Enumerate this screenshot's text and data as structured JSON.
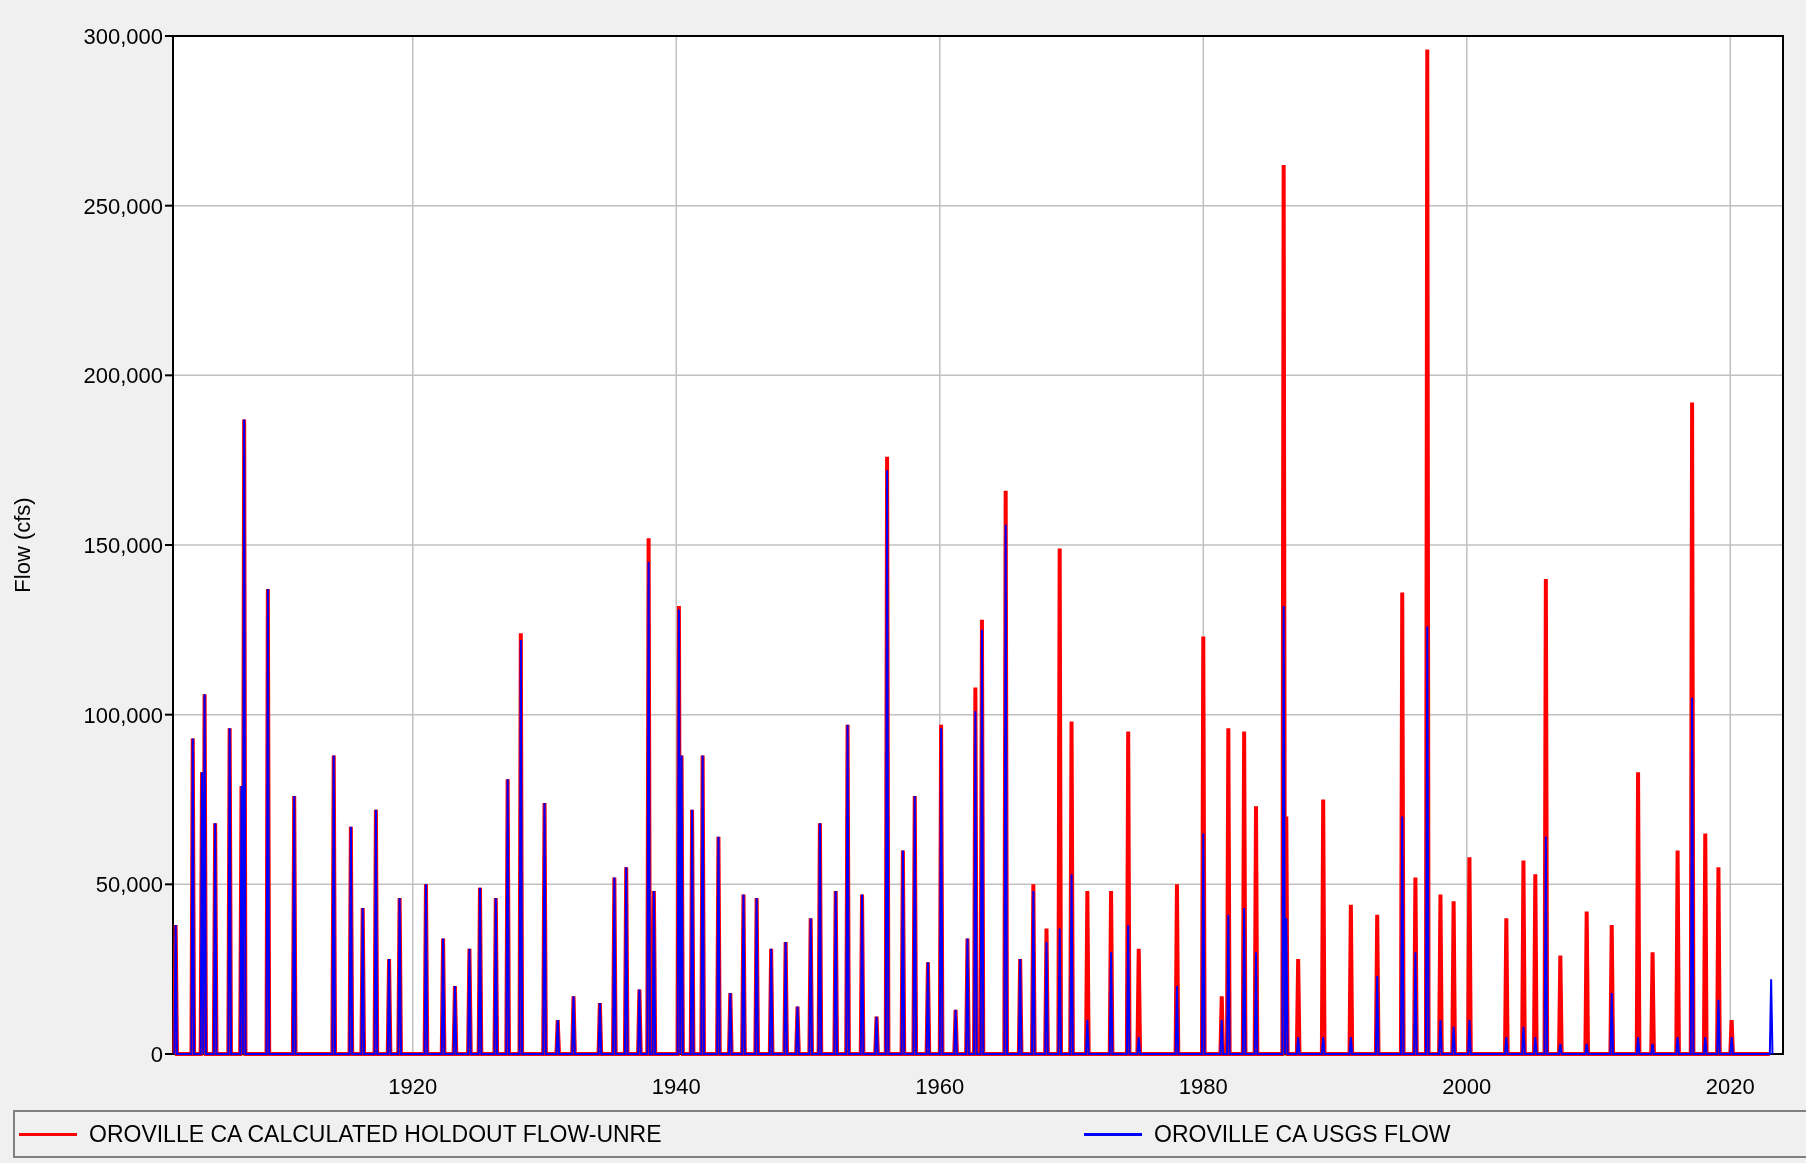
{
  "chart": {
    "chart_data": {
      "type": "line",
      "grid": true,
      "ylabel": "Flow (cfs)",
      "xlim": [
        1901.8,
        2024
      ],
      "ylim": [
        0,
        300000
      ],
      "xticks": [
        1920,
        1940,
        1960,
        1980,
        2000,
        2020
      ],
      "yticks": [
        {
          "value": 0,
          "label": "0"
        },
        {
          "value": 50000,
          "label": "50,000"
        },
        {
          "value": 100000,
          "label": "100,000"
        },
        {
          "value": 150000,
          "label": "150,000"
        },
        {
          "value": 200000,
          "label": "200,000"
        },
        {
          "value": 250000,
          "label": "250,000"
        },
        {
          "value": 300000,
          "label": "300,000"
        }
      ],
      "x": [
        1901.9,
        1902,
        1902.1,
        1903.2,
        1903.3,
        1903.4,
        1903.9,
        1904,
        1904.1,
        1904.1,
        1904.2,
        1904.3,
        1904.9,
        1905,
        1905.1,
        1906,
        1906.1,
        1906.2,
        1906.9,
        1907,
        1907.1,
        1907.1,
        1907.2,
        1907.3,
        1908.9,
        1909,
        1909.1,
        1910.9,
        1911,
        1911.1,
        1913.9,
        1914,
        1914.1,
        1915.2,
        1915.3,
        1915.4,
        1916.1,
        1916.2,
        1916.3,
        1917.1,
        1917.2,
        1917.3,
        1918.1,
        1918.2,
        1918.3,
        1918.9,
        1919,
        1919.1,
        1920.9,
        1921,
        1921.1,
        1922.2,
        1922.3,
        1922.4,
        1923.1,
        1923.2,
        1923.3,
        1924.2,
        1924.3,
        1924.4,
        1925,
        1925.1,
        1925.2,
        1926.2,
        1926.3,
        1926.4,
        1927.1,
        1927.2,
        1927.3,
        1928.1,
        1928.2,
        1928.3,
        1929.9,
        1930,
        1930.1,
        1930.9,
        1931,
        1931.1,
        1932.1,
        1932.2,
        1932.3,
        1934.1,
        1934.2,
        1934.3,
        1935.2,
        1935.3,
        1935.4,
        1936.1,
        1936.2,
        1936.3,
        1937.1,
        1937.2,
        1937.3,
        1937.8,
        1937.9,
        1938,
        1938.2,
        1938.3,
        1938.4,
        1940.1,
        1940.2,
        1940.3,
        1940.3,
        1940.4,
        1940.5,
        1941.1,
        1941.2,
        1941.3,
        1941.9,
        1942,
        1942.1,
        1943.1,
        1943.2,
        1943.3,
        1944,
        1944.1,
        1944.2,
        1945,
        1945.1,
        1945.2,
        1946,
        1946.1,
        1946.2,
        1947.1,
        1947.2,
        1947.3,
        1948.2,
        1948.3,
        1948.4,
        1949.1,
        1949.2,
        1949.3,
        1950.1,
        1950.2,
        1950.3,
        1950.8,
        1950.9,
        1951,
        1952,
        1952.1,
        1952.2,
        1952.9,
        1953,
        1953.1,
        1954,
        1954.1,
        1954.2,
        1955.1,
        1955.2,
        1955.3,
        1955.9,
        1956,
        1956.1,
        1957.1,
        1957.2,
        1957.3,
        1958,
        1958.1,
        1958.2,
        1959,
        1959.1,
        1959.2,
        1960,
        1960.1,
        1960.2,
        1961.1,
        1961.2,
        1961.3,
        1962,
        1962.1,
        1962.2,
        1962.6,
        1962.7,
        1962.8,
        1963.1,
        1963.2,
        1963.3,
        1964.9,
        1965,
        1965.1,
        1966,
        1966.1,
        1966.2,
        1967,
        1967.1,
        1967.2,
        1968,
        1968.1,
        1968.2,
        1969,
        1969.1,
        1969.2,
        1969.9,
        1970,
        1970.1,
        1971.1,
        1971.2,
        1971.3,
        1972.9,
        1973,
        1973.1,
        1974.2,
        1974.3,
        1974.4,
        1975,
        1975.1,
        1975.2,
        1977.9,
        1978,
        1978.1,
        1979.9,
        1980,
        1980.1,
        1981.3,
        1981.4,
        1981.5,
        1981.8,
        1981.9,
        1982,
        1983,
        1983.1,
        1983.2,
        1983.9,
        1984,
        1984.1,
        1986,
        1986.1,
        1986.2,
        1986.2,
        1986.3,
        1986.4,
        1987.1,
        1987.2,
        1987.3,
        1989,
        1989.1,
        1989.2,
        1991.1,
        1991.2,
        1991.3,
        1993.1,
        1993.2,
        1993.3,
        1995,
        1995.1,
        1995.2,
        1996,
        1996.1,
        1996.2,
        1996.9,
        1997,
        1997.1,
        1997.9,
        1998,
        1998.1,
        1998.9,
        1999,
        1999.1,
        2000.1,
        2000.2,
        2000.3,
        2002.9,
        2003,
        2003.1,
        2004.2,
        2004.3,
        2004.4,
        2005.1,
        2005.2,
        2005.3,
        2005.9,
        2006,
        2006.1,
        2007,
        2007.1,
        2007.2,
        2009,
        2009.1,
        2009.2,
        2010.9,
        2011,
        2011.1,
        2012.9,
        2013,
        2013.1,
        2014,
        2014.1,
        2014.2,
        2015.9,
        2016,
        2016.1,
        2017,
        2017.1,
        2017.2,
        2018,
        2018.1,
        2018.2,
        2019,
        2019.1,
        2019.2,
        2020,
        2020.1,
        2020.2,
        2023,
        2023.1,
        2023.2
      ],
      "series": [
        {
          "name": "OROVILLE CA CALCULATED HOLDOUT FLOW-UNRE",
          "color": "#ff0000",
          "values": [
            0,
            38000,
            0,
            0,
            93000,
            0,
            0,
            83000,
            0,
            0,
            106000,
            0,
            0,
            68000,
            0,
            0,
            96000,
            0,
            0,
            79000,
            0,
            0,
            187000,
            0,
            0,
            137000,
            0,
            0,
            76000,
            0,
            0,
            88000,
            0,
            0,
            67000,
            0,
            0,
            43000,
            0,
            0,
            72000,
            0,
            0,
            28000,
            0,
            0,
            46000,
            0,
            0,
            50000,
            0,
            0,
            34000,
            0,
            0,
            20000,
            0,
            0,
            31000,
            0,
            0,
            49000,
            0,
            0,
            46000,
            0,
            0,
            81000,
            0,
            0,
            124000,
            0,
            0,
            74000,
            0,
            0,
            10000,
            0,
            0,
            17000,
            0,
            0,
            15000,
            0,
            0,
            52000,
            0,
            0,
            55000,
            0,
            0,
            19000,
            0,
            0,
            152000,
            0,
            0,
            48000,
            0,
            0,
            132000,
            0,
            0,
            88000,
            0,
            0,
            72000,
            0,
            0,
            88000,
            0,
            0,
            64000,
            0,
            0,
            18000,
            0,
            0,
            47000,
            0,
            0,
            46000,
            0,
            0,
            31000,
            0,
            0,
            33000,
            0,
            0,
            14000,
            0,
            0,
            40000,
            0,
            0,
            68000,
            0,
            0,
            48000,
            0,
            0,
            97000,
            0,
            0,
            47000,
            0,
            0,
            11000,
            0,
            0,
            176000,
            0,
            0,
            60000,
            0,
            0,
            76000,
            0,
            0,
            27000,
            0,
            0,
            97000,
            0,
            0,
            13000,
            0,
            0,
            34000,
            0,
            0,
            108000,
            0,
            0,
            128000,
            0,
            0,
            166000,
            0,
            0,
            28000,
            0,
            0,
            50000,
            0,
            0,
            37000,
            0,
            0,
            149000,
            0,
            0,
            98000,
            0,
            0,
            48000,
            0,
            0,
            48000,
            0,
            0,
            95000,
            0,
            0,
            31000,
            0,
            0,
            50000,
            0,
            0,
            123000,
            0,
            0,
            17000,
            0,
            0,
            96000,
            0,
            0,
            95000,
            0,
            0,
            73000,
            0,
            0,
            262000,
            0,
            0,
            70000,
            0,
            0,
            28000,
            0,
            0,
            75000,
            0,
            0,
            44000,
            0,
            0,
            41000,
            0,
            0,
            136000,
            0,
            0,
            52000,
            0,
            0,
            296000,
            0,
            0,
            47000,
            0,
            0,
            45000,
            0,
            0,
            58000,
            0,
            0,
            40000,
            0,
            0,
            57000,
            0,
            0,
            53000,
            0,
            0,
            140000,
            0,
            0,
            29000,
            0,
            0,
            42000,
            0,
            0,
            38000,
            0,
            0,
            83000,
            0,
            0,
            30000,
            0,
            0,
            60000,
            0,
            0,
            192000,
            0,
            0,
            65000,
            0,
            0,
            55000,
            0,
            0,
            10000,
            0,
            0,
            null,
            0
          ]
        },
        {
          "name": "OROVILLE CA USGS FLOW",
          "color": "#0000ff",
          "values": [
            0,
            38000,
            0,
            0,
            93000,
            0,
            0,
            83000,
            0,
            0,
            106000,
            0,
            0,
            68000,
            0,
            0,
            96000,
            0,
            0,
            79000,
            0,
            0,
            187000,
            0,
            0,
            137000,
            0,
            0,
            76000,
            0,
            0,
            88000,
            0,
            0,
            67000,
            0,
            0,
            43000,
            0,
            0,
            72000,
            0,
            0,
            28000,
            0,
            0,
            46000,
            0,
            0,
            50000,
            0,
            0,
            34000,
            0,
            0,
            20000,
            0,
            0,
            31000,
            0,
            0,
            49000,
            0,
            0,
            46000,
            0,
            0,
            81000,
            0,
            0,
            122000,
            0,
            0,
            74000,
            0,
            0,
            10000,
            0,
            0,
            17000,
            0,
            0,
            15000,
            0,
            0,
            52000,
            0,
            0,
            55000,
            0,
            0,
            19000,
            0,
            0,
            145000,
            0,
            0,
            48000,
            0,
            0,
            131000,
            0,
            0,
            88000,
            0,
            0,
            72000,
            0,
            0,
            88000,
            0,
            0,
            64000,
            0,
            0,
            18000,
            0,
            0,
            47000,
            0,
            0,
            46000,
            0,
            0,
            31000,
            0,
            0,
            33000,
            0,
            0,
            14000,
            0,
            0,
            40000,
            0,
            0,
            68000,
            0,
            0,
            48000,
            0,
            0,
            97000,
            0,
            0,
            47000,
            0,
            0,
            11000,
            0,
            0,
            172000,
            0,
            0,
            60000,
            0,
            0,
            76000,
            0,
            0,
            27000,
            0,
            0,
            96000,
            0,
            0,
            13000,
            0,
            0,
            34000,
            0,
            0,
            101000,
            0,
            0,
            125000,
            0,
            0,
            156000,
            0,
            0,
            28000,
            0,
            0,
            48000,
            0,
            0,
            33000,
            0,
            0,
            37000,
            0,
            0,
            53000,
            0,
            0,
            10000,
            0,
            0,
            30000,
            0,
            0,
            38000,
            0,
            0,
            5000,
            0,
            0,
            20000,
            0,
            0,
            65000,
            0,
            0,
            10000,
            0,
            0,
            41000,
            0,
            0,
            43000,
            0,
            0,
            30000,
            0,
            0,
            132000,
            0,
            0,
            40000,
            0,
            0,
            5000,
            0,
            0,
            5000,
            0,
            0,
            5000,
            0,
            0,
            23000,
            0,
            0,
            70000,
            0,
            0,
            30000,
            0,
            0,
            126000,
            0,
            0,
            10000,
            0,
            0,
            8000,
            0,
            0,
            10000,
            0,
            0,
            5000,
            0,
            0,
            8000,
            0,
            0,
            5000,
            0,
            0,
            64000,
            0,
            0,
            3000,
            0,
            0,
            3000,
            0,
            0,
            18000,
            0,
            0,
            5000,
            0,
            0,
            3000,
            0,
            0,
            5000,
            0,
            0,
            105000,
            0,
            0,
            5000,
            0,
            0,
            16000,
            0,
            0,
            5000,
            0,
            0,
            22000,
            0
          ]
        }
      ]
    }
  }
}
